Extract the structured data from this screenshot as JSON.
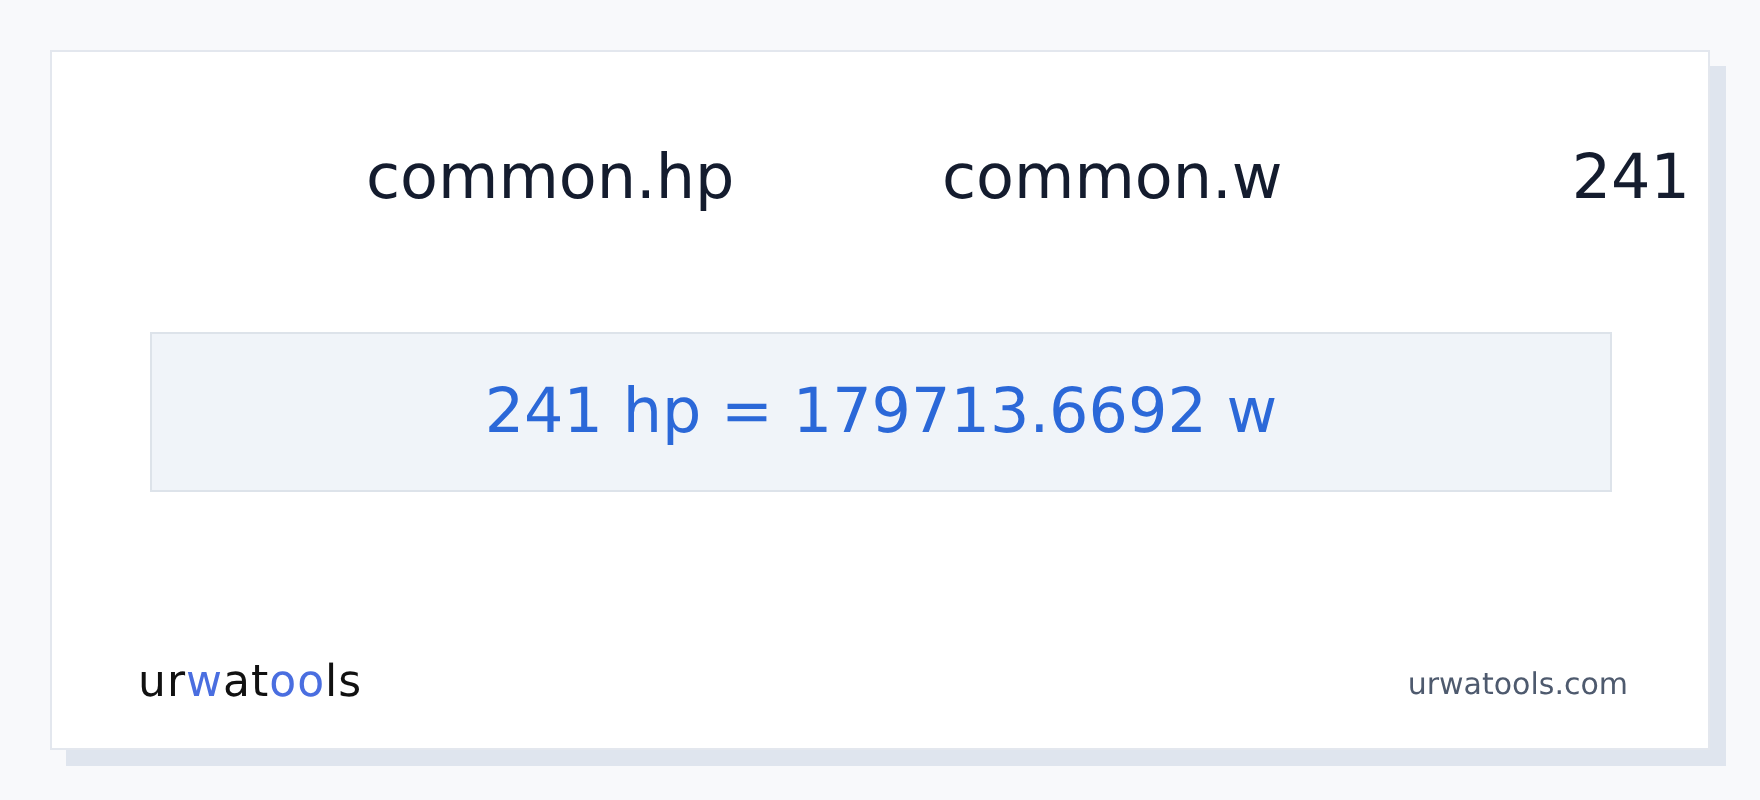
{
  "conversion": {
    "from_unit": "common.hp",
    "to_unit": "common.w",
    "value": "241"
  },
  "result": "241 hp = 179713.6692 w",
  "footer": {
    "logo": [
      {
        "text": "ur",
        "accent": false
      },
      {
        "text": "w",
        "accent": true
      },
      {
        "text": "at",
        "accent": false
      },
      {
        "text": "oo",
        "accent": true
      },
      {
        "text": "ls",
        "accent": false
      }
    ],
    "site": "urwatools.com"
  }
}
